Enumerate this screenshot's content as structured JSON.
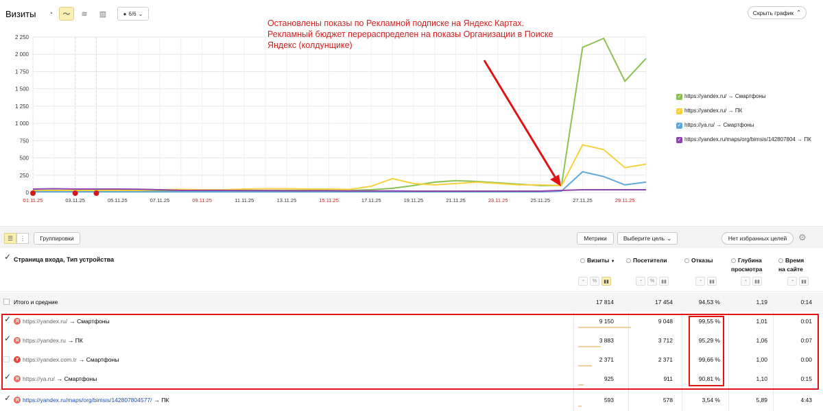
{
  "header": {
    "title": "Визиты",
    "counter": "6/6",
    "collapse_label": "Скрыть график"
  },
  "annotation": {
    "text": "Остановлены показы по Рекламной подписке на Яндекс Картах. Рекламный бюджет перераспределен на показы Организации в Поиске Яндекс (колдунщике)"
  },
  "chart_data": {
    "type": "line",
    "x": [
      "01.11.25",
      "02.11.25",
      "03.11.25",
      "04.11.25",
      "05.11.25",
      "06.11.25",
      "07.11.25",
      "08.11.25",
      "09.11.25",
      "10.11.25",
      "11.11.25",
      "12.11.25",
      "13.11.25",
      "14.11.25",
      "15.11.25",
      "16.11.25",
      "17.11.25",
      "18.11.25",
      "19.11.25",
      "20.11.25",
      "21.11.25",
      "22.11.25",
      "23.11.25",
      "24.11.25",
      "25.11.25",
      "26.11.25",
      "27.11.25",
      "28.11.25",
      "29.11.25",
      "30.11.25"
    ],
    "x_tick_labels": [
      "01.11.25",
      "03.11.25",
      "05.11.25",
      "07.11.25",
      "09.11.25",
      "11.11.25",
      "13.11.25",
      "15.11.25",
      "17.11.25",
      "19.11.25",
      "21.11.25",
      "23.11.25",
      "25.11.25",
      "27.11.25",
      "29.11.25"
    ],
    "red_ticks": [
      "01.11.25",
      "09.11.25",
      "15.11.25",
      "23.11.25",
      "29.11.25"
    ],
    "ylim": [
      0,
      2250
    ],
    "y_ticks": [
      0,
      250,
      500,
      750,
      1000,
      1250,
      1500,
      1750,
      2000,
      2250
    ],
    "y_tick_labels": [
      "0",
      "250",
      "500",
      "750",
      "1 000",
      "1 250",
      "1 500",
      "1 750",
      "2 000",
      "2 250"
    ],
    "series": [
      {
        "name": "https://yandex.ru/ → Смартфоны",
        "color": "#8cc152",
        "values": [
          30,
          30,
          30,
          30,
          30,
          30,
          30,
          30,
          30,
          30,
          30,
          30,
          30,
          30,
          30,
          30,
          40,
          60,
          100,
          150,
          170,
          160,
          140,
          120,
          100,
          100,
          2100,
          2230,
          1610,
          1940
        ]
      },
      {
        "name": "https://yandex.ru/ → ПК",
        "color": "#f6d13f",
        "values": [
          25,
          28,
          30,
          30,
          30,
          30,
          40,
          45,
          40,
          40,
          50,
          55,
          55,
          50,
          50,
          45,
          90,
          200,
          130,
          110,
          130,
          150,
          130,
          110,
          110,
          100,
          690,
          620,
          360,
          410
        ]
      },
      {
        "name": "https://ya.ru/ → Смартфоны",
        "color": "#5ea8dc",
        "values": [
          10,
          10,
          10,
          10,
          10,
          10,
          10,
          10,
          10,
          10,
          10,
          10,
          10,
          10,
          10,
          10,
          10,
          10,
          10,
          10,
          10,
          10,
          10,
          10,
          10,
          20,
          300,
          230,
          110,
          150
        ]
      },
      {
        "name": "https://yandex.ru/maps/org/bimsis/142807804 → ПК",
        "color": "#8e44ad",
        "values": [
          50,
          55,
          50,
          50,
          50,
          48,
          40,
          30,
          30,
          30,
          28,
          28,
          25,
          25,
          25,
          22,
          22,
          22,
          20,
          20,
          20,
          20,
          20,
          20,
          20,
          30,
          40,
          40,
          40,
          40
        ]
      }
    ],
    "markers": [
      "01.11.25",
      "03.11.25",
      "04.11.25"
    ],
    "grid": true,
    "legend_position": "right"
  },
  "toolbar": {
    "groupings_label": "Группировки",
    "metrics_label": "Метрики",
    "goal_label": "Выберите цель",
    "favorites_label": "Нет избранных целей"
  },
  "table": {
    "dimension_header": "Страница входа, Тип устройства",
    "columns": [
      {
        "label": "Визиты",
        "sort": "▼"
      },
      {
        "label": "Посетители"
      },
      {
        "label": "Отказы"
      },
      {
        "label1": "Глубина",
        "label2": "просмотра"
      },
      {
        "label1": "Время",
        "label2": "на сайте"
      }
    ],
    "total_label": "Итого и средние",
    "totals": [
      "17 814",
      "17 454",
      "94,53 %",
      "1,19",
      "0:14"
    ],
    "rows": [
      {
        "url": "https://yandex.ru/",
        "device": "→ Смартфоны",
        "icon": "Я",
        "checked": true,
        "values": [
          "9 150",
          "9 048",
          "99,55 %",
          "1,01",
          "0:01"
        ],
        "bar": 0.51
      },
      {
        "url": "https://yandex.ru",
        "device": "→ ПК",
        "icon": "Я",
        "checked": true,
        "values": [
          "3 883",
          "3 712",
          "95,29 %",
          "1,06",
          "0:07"
        ],
        "bar": 0.22
      },
      {
        "url": "https://yandex.com.tr",
        "device": "→ Смартфоны",
        "icon": "Y",
        "checked": false,
        "values": [
          "2 371",
          "2 371",
          "99,66 %",
          "1,00",
          "0:00"
        ],
        "bar": 0.13
      },
      {
        "url": "https://ya.ru/",
        "device": "→ Смартфоны",
        "icon": "Я",
        "checked": true,
        "values": [
          "925",
          "911",
          "90,81 %",
          "1,10",
          "0:15"
        ],
        "bar": 0.05
      },
      {
        "url": "https://yandex.ru/maps/org/bimsis/142807804577/",
        "device": "→ ПК",
        "icon": "Я",
        "checked": true,
        "values": [
          "593",
          "578",
          "3,54 %",
          "5,89",
          "4:43"
        ],
        "bar": 0.03
      }
    ]
  }
}
